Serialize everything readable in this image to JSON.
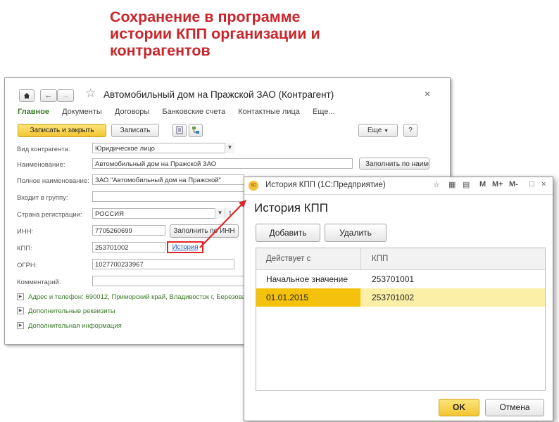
{
  "slide": {
    "title_lines": [
      "Сохранение в программе",
      "истории КПП организации и",
      "контрагентов"
    ]
  },
  "main": {
    "nav": {
      "home_icon": "home-icon",
      "back_icon": "arrow-left-icon",
      "forward_icon": "arrow-right-icon",
      "favorite_icon": "star-icon"
    },
    "title": "Автомобильный дом на Пражской ЗАО (Контрагент)",
    "tabs": [
      {
        "label": "Главное",
        "active": true
      },
      {
        "label": "Документы",
        "active": false
      },
      {
        "label": "Договоры",
        "active": false
      },
      {
        "label": "Банковские счета",
        "active": false
      },
      {
        "label": "Контактные лица",
        "active": false
      },
      {
        "label": "Еще...",
        "active": false
      }
    ],
    "toolbar": {
      "save_close": "Записать и закрыть",
      "save": "Записать",
      "more": "Еще",
      "help": "?"
    },
    "fields": {
      "type_label": "Вид контрагента:",
      "type_value": "Юридическое лицо",
      "name_label": "Наименование:",
      "name_value": "Автомобильный дом на Пражской ЗАО",
      "fill_by_name": "Заполнить по наиме",
      "full_name_label": "Полное наименование:",
      "full_name_value": "ЗАО \"Автомобильный дом на Пражской\"",
      "group_label": "Входит в группу:",
      "country_label": "Страна регистрации:",
      "country_value": "РОССИЯ",
      "inn_label": "ИНН:",
      "inn_value": "7705260699",
      "fill_by_inn": "Заполнить по ИНН",
      "kpp_label": "КПП:",
      "kpp_value": "253701002",
      "history_link": "История",
      "ogrn_label": "ОГРН:",
      "ogrn_value": "1027700233967",
      "comment_label": "Комментарий:"
    },
    "sections": {
      "address": "Адрес и телефон: 690012, Приморский край, Владивосток г, Березова",
      "extra_details": "Дополнительные реквизиты",
      "extra_info": "Дополнительная информация"
    }
  },
  "dialog": {
    "window_title": "История КПП  (1С:Предприятие)",
    "toolbar_icons": [
      "star-icon",
      "calendar-icon",
      "calculator-icon",
      "M",
      "M+",
      "M-",
      "minimize-icon",
      "close-icon"
    ],
    "mem_labels": [
      "M",
      "M+",
      "M-"
    ],
    "heading": "История КПП",
    "add_button": "Добавить",
    "delete_button": "Удалить",
    "columns": [
      "Действует с",
      "КПП"
    ],
    "rows": [
      {
        "date": "Начальное значение",
        "kpp": "253701001",
        "selected": false
      },
      {
        "date": "01.01.2015",
        "kpp": "253701002",
        "selected": true
      }
    ],
    "ok_button": "OK",
    "cancel_button": "Отмена"
  },
  "colors": {
    "title_red": "#c9252b",
    "accent_yellow": "#f4c20d",
    "selection": "#fbeea7",
    "link_green": "#3a7b28",
    "highlight_red": "#e02424"
  }
}
